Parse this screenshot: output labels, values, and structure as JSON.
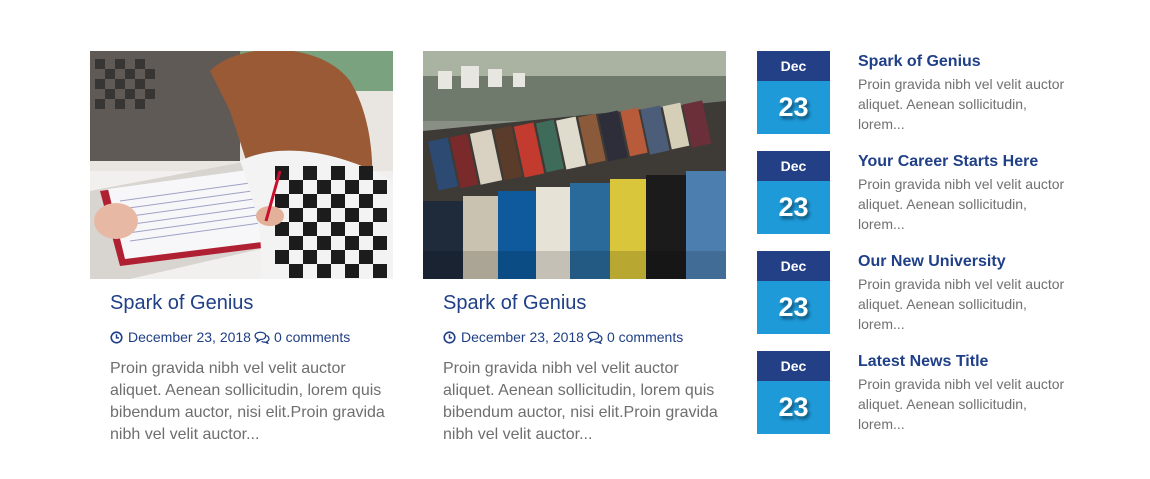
{
  "posts": [
    {
      "title": "Spark of Genius",
      "date": "December 23, 2018",
      "comments": "0 comments",
      "excerpt": "Proin gravida nibh vel velit auctor aliquet. Aenean sollicitudin, lorem quis bibendum auctor, nisi elit.Proin gravida nibh vel velit auctor...",
      "image": "student-writing-photo"
    },
    {
      "title": "Spark of Genius",
      "date": "December 23, 2018",
      "comments": "0 comments",
      "excerpt": "Proin gravida nibh vel velit auctor aliquet. Aenean sollicitudin, lorem quis bibendum auctor, nisi elit.Proin gravida nibh vel velit auctor...",
      "image": "bookstall-photo"
    }
  ],
  "news": [
    {
      "month": "Dec",
      "day": "23",
      "title": "Spark of Genius",
      "excerpt": "Proin gravida nibh vel velit auctor aliquet. Aenean sollicitudin, lorem..."
    },
    {
      "month": "Dec",
      "day": "23",
      "title": "Your Career Starts Here",
      "excerpt": "Proin gravida nibh vel velit auctor aliquet. Aenean sollicitudin, lorem..."
    },
    {
      "month": "Dec",
      "day": "23",
      "title": "Our New University",
      "excerpt": "Proin gravida nibh vel velit auctor aliquet. Aenean sollicitudin, lorem..."
    },
    {
      "month": "Dec",
      "day": "23",
      "title": "Latest News Title",
      "excerpt": "Proin gravida nibh vel velit auctor aliquet. Aenean sollicitudin, lorem..."
    }
  ],
  "colors": {
    "title_blue": "#1f3f87",
    "month_bg": "#233f86",
    "day_bg": "#1e9ad9",
    "text_gray": "#6e6e6e"
  },
  "icons": {
    "date": "clock-icon",
    "comments": "comments-icon"
  }
}
